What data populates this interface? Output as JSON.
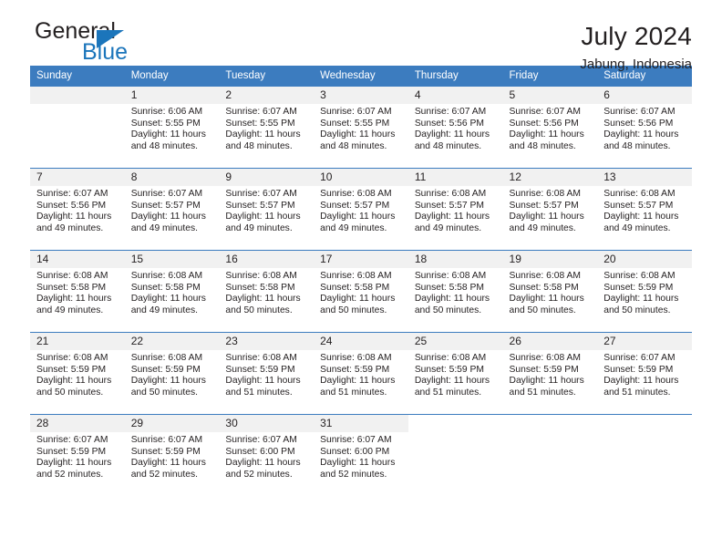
{
  "brand": {
    "name_top": "General",
    "name_bottom": "Blue",
    "triangle_color": "#1b75bb",
    "icon": "triangle-icon"
  },
  "header": {
    "title": "July 2024",
    "subtitle": "Jabung, Indonesia"
  },
  "theme": {
    "header_bg": "#3c7cbf",
    "daynum_bg": "#f1f1f1",
    "text": "#231f20",
    "accent": "#1b75bb"
  },
  "weekday_headers": [
    "Sunday",
    "Monday",
    "Tuesday",
    "Wednesday",
    "Thursday",
    "Friday",
    "Saturday"
  ],
  "weeks": [
    [
      {
        "day": "",
        "sunrise": "",
        "sunset": "",
        "daylight_line1": "",
        "daylight_line2": "",
        "empty": true
      },
      {
        "day": "1",
        "sunrise": "Sunrise: 6:06 AM",
        "sunset": "Sunset: 5:55 PM",
        "daylight_line1": "Daylight: 11 hours",
        "daylight_line2": "and 48 minutes."
      },
      {
        "day": "2",
        "sunrise": "Sunrise: 6:07 AM",
        "sunset": "Sunset: 5:55 PM",
        "daylight_line1": "Daylight: 11 hours",
        "daylight_line2": "and 48 minutes."
      },
      {
        "day": "3",
        "sunrise": "Sunrise: 6:07 AM",
        "sunset": "Sunset: 5:55 PM",
        "daylight_line1": "Daylight: 11 hours",
        "daylight_line2": "and 48 minutes."
      },
      {
        "day": "4",
        "sunrise": "Sunrise: 6:07 AM",
        "sunset": "Sunset: 5:56 PM",
        "daylight_line1": "Daylight: 11 hours",
        "daylight_line2": "and 48 minutes."
      },
      {
        "day": "5",
        "sunrise": "Sunrise: 6:07 AM",
        "sunset": "Sunset: 5:56 PM",
        "daylight_line1": "Daylight: 11 hours",
        "daylight_line2": "and 48 minutes."
      },
      {
        "day": "6",
        "sunrise": "Sunrise: 6:07 AM",
        "sunset": "Sunset: 5:56 PM",
        "daylight_line1": "Daylight: 11 hours",
        "daylight_line2": "and 48 minutes."
      }
    ],
    [
      {
        "day": "7",
        "sunrise": "Sunrise: 6:07 AM",
        "sunset": "Sunset: 5:56 PM",
        "daylight_line1": "Daylight: 11 hours",
        "daylight_line2": "and 49 minutes."
      },
      {
        "day": "8",
        "sunrise": "Sunrise: 6:07 AM",
        "sunset": "Sunset: 5:57 PM",
        "daylight_line1": "Daylight: 11 hours",
        "daylight_line2": "and 49 minutes."
      },
      {
        "day": "9",
        "sunrise": "Sunrise: 6:07 AM",
        "sunset": "Sunset: 5:57 PM",
        "daylight_line1": "Daylight: 11 hours",
        "daylight_line2": "and 49 minutes."
      },
      {
        "day": "10",
        "sunrise": "Sunrise: 6:08 AM",
        "sunset": "Sunset: 5:57 PM",
        "daylight_line1": "Daylight: 11 hours",
        "daylight_line2": "and 49 minutes."
      },
      {
        "day": "11",
        "sunrise": "Sunrise: 6:08 AM",
        "sunset": "Sunset: 5:57 PM",
        "daylight_line1": "Daylight: 11 hours",
        "daylight_line2": "and 49 minutes."
      },
      {
        "day": "12",
        "sunrise": "Sunrise: 6:08 AM",
        "sunset": "Sunset: 5:57 PM",
        "daylight_line1": "Daylight: 11 hours",
        "daylight_line2": "and 49 minutes."
      },
      {
        "day": "13",
        "sunrise": "Sunrise: 6:08 AM",
        "sunset": "Sunset: 5:57 PM",
        "daylight_line1": "Daylight: 11 hours",
        "daylight_line2": "and 49 minutes."
      }
    ],
    [
      {
        "day": "14",
        "sunrise": "Sunrise: 6:08 AM",
        "sunset": "Sunset: 5:58 PM",
        "daylight_line1": "Daylight: 11 hours",
        "daylight_line2": "and 49 minutes."
      },
      {
        "day": "15",
        "sunrise": "Sunrise: 6:08 AM",
        "sunset": "Sunset: 5:58 PM",
        "daylight_line1": "Daylight: 11 hours",
        "daylight_line2": "and 49 minutes."
      },
      {
        "day": "16",
        "sunrise": "Sunrise: 6:08 AM",
        "sunset": "Sunset: 5:58 PM",
        "daylight_line1": "Daylight: 11 hours",
        "daylight_line2": "and 50 minutes."
      },
      {
        "day": "17",
        "sunrise": "Sunrise: 6:08 AM",
        "sunset": "Sunset: 5:58 PM",
        "daylight_line1": "Daylight: 11 hours",
        "daylight_line2": "and 50 minutes."
      },
      {
        "day": "18",
        "sunrise": "Sunrise: 6:08 AM",
        "sunset": "Sunset: 5:58 PM",
        "daylight_line1": "Daylight: 11 hours",
        "daylight_line2": "and 50 minutes."
      },
      {
        "day": "19",
        "sunrise": "Sunrise: 6:08 AM",
        "sunset": "Sunset: 5:58 PM",
        "daylight_line1": "Daylight: 11 hours",
        "daylight_line2": "and 50 minutes."
      },
      {
        "day": "20",
        "sunrise": "Sunrise: 6:08 AM",
        "sunset": "Sunset: 5:59 PM",
        "daylight_line1": "Daylight: 11 hours",
        "daylight_line2": "and 50 minutes."
      }
    ],
    [
      {
        "day": "21",
        "sunrise": "Sunrise: 6:08 AM",
        "sunset": "Sunset: 5:59 PM",
        "daylight_line1": "Daylight: 11 hours",
        "daylight_line2": "and 50 minutes."
      },
      {
        "day": "22",
        "sunrise": "Sunrise: 6:08 AM",
        "sunset": "Sunset: 5:59 PM",
        "daylight_line1": "Daylight: 11 hours",
        "daylight_line2": "and 50 minutes."
      },
      {
        "day": "23",
        "sunrise": "Sunrise: 6:08 AM",
        "sunset": "Sunset: 5:59 PM",
        "daylight_line1": "Daylight: 11 hours",
        "daylight_line2": "and 51 minutes."
      },
      {
        "day": "24",
        "sunrise": "Sunrise: 6:08 AM",
        "sunset": "Sunset: 5:59 PM",
        "daylight_line1": "Daylight: 11 hours",
        "daylight_line2": "and 51 minutes."
      },
      {
        "day": "25",
        "sunrise": "Sunrise: 6:08 AM",
        "sunset": "Sunset: 5:59 PM",
        "daylight_line1": "Daylight: 11 hours",
        "daylight_line2": "and 51 minutes."
      },
      {
        "day": "26",
        "sunrise": "Sunrise: 6:08 AM",
        "sunset": "Sunset: 5:59 PM",
        "daylight_line1": "Daylight: 11 hours",
        "daylight_line2": "and 51 minutes."
      },
      {
        "day": "27",
        "sunrise": "Sunrise: 6:07 AM",
        "sunset": "Sunset: 5:59 PM",
        "daylight_line1": "Daylight: 11 hours",
        "daylight_line2": "and 51 minutes."
      }
    ],
    [
      {
        "day": "28",
        "sunrise": "Sunrise: 6:07 AM",
        "sunset": "Sunset: 5:59 PM",
        "daylight_line1": "Daylight: 11 hours",
        "daylight_line2": "and 52 minutes."
      },
      {
        "day": "29",
        "sunrise": "Sunrise: 6:07 AM",
        "sunset": "Sunset: 5:59 PM",
        "daylight_line1": "Daylight: 11 hours",
        "daylight_line2": "and 52 minutes."
      },
      {
        "day": "30",
        "sunrise": "Sunrise: 6:07 AM",
        "sunset": "Sunset: 6:00 PM",
        "daylight_line1": "Daylight: 11 hours",
        "daylight_line2": "and 52 minutes."
      },
      {
        "day": "31",
        "sunrise": "Sunrise: 6:07 AM",
        "sunset": "Sunset: 6:00 PM",
        "daylight_line1": "Daylight: 11 hours",
        "daylight_line2": "and 52 minutes."
      },
      {
        "day": "",
        "sunrise": "",
        "sunset": "",
        "daylight_line1": "",
        "daylight_line2": "",
        "empty": true,
        "blank": true
      },
      {
        "day": "",
        "sunrise": "",
        "sunset": "",
        "daylight_line1": "",
        "daylight_line2": "",
        "empty": true,
        "blank": true
      },
      {
        "day": "",
        "sunrise": "",
        "sunset": "",
        "daylight_line1": "",
        "daylight_line2": "",
        "empty": true,
        "blank": true
      }
    ]
  ]
}
